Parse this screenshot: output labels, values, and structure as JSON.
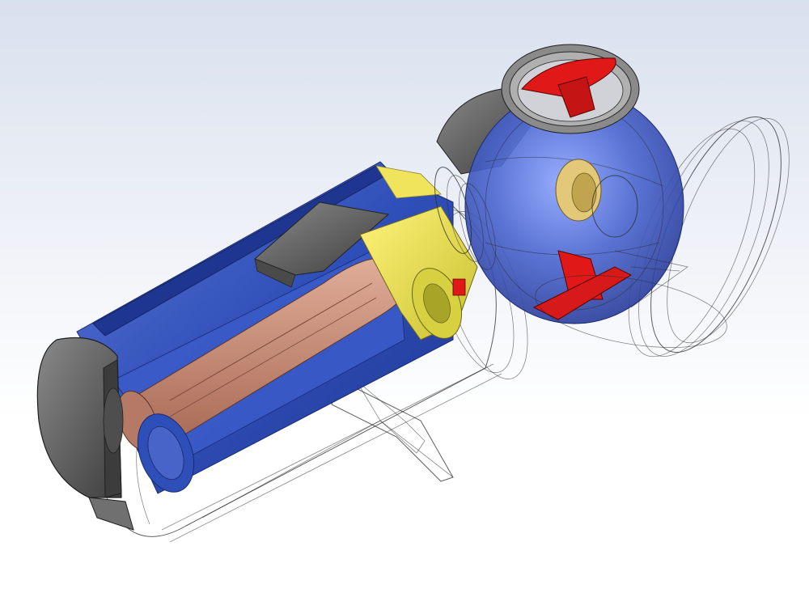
{
  "colors": {
    "background_top": "#d9e0ee",
    "background_bottom": "#ffffff",
    "housing_blue": "#2f4fb8",
    "housing_blue_light": "#5a76d6",
    "end_cap_gray": "#5e5e5e",
    "shaft_copper": "#c98b76",
    "bearing_yellow": "#e6e04a",
    "bushing_tan": "#d9c06a",
    "valve_red": "#e01818",
    "transparent_shell": "#cfd2d8"
  },
  "parts": [
    "end-cap",
    "blue-housing",
    "copper-shaft",
    "yellow-coupling",
    "spherical-valve-body",
    "red-valve-disc",
    "tan-bushing",
    "transparent-outer-shell",
    "trigger-handle",
    "outlet-flange"
  ]
}
